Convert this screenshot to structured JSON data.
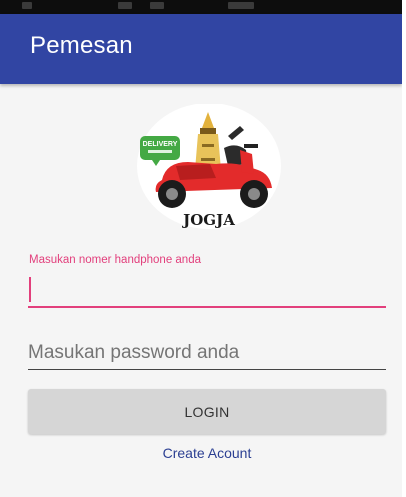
{
  "app_bar": {
    "title": "Pemesan",
    "color": "#3145a3"
  },
  "logo": {
    "badge_text": "DELIVERY",
    "city_text": "JOGJA",
    "scooter_color": "#e32b2b"
  },
  "form": {
    "phone_label": "Masukan nomer handphone anda",
    "phone_value": "",
    "password_placeholder": "Masukan password anda",
    "accent_color": "#e23f7c"
  },
  "actions": {
    "login_label": "LOGIN",
    "create_account_label": "Create Acount"
  }
}
